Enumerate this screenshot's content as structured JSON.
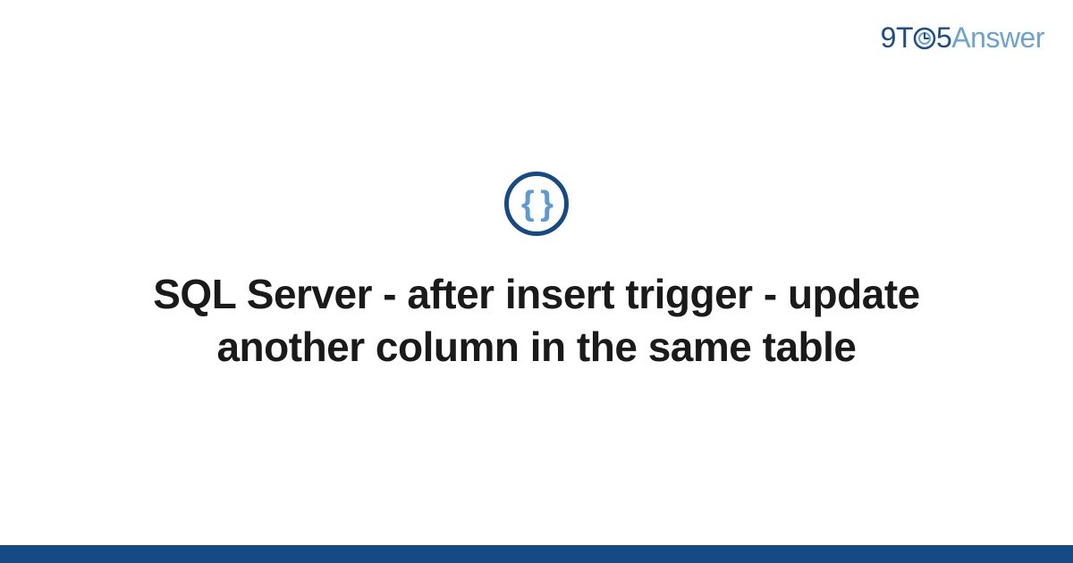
{
  "logo": {
    "part1": "9T",
    "part2": "5",
    "part3": "Answer"
  },
  "icon": {
    "braces": "{ }"
  },
  "title": "SQL Server - after insert trigger - update another column in the same table",
  "colors": {
    "brand_dark": "#164a85",
    "brand_light": "#5a9bd4"
  }
}
